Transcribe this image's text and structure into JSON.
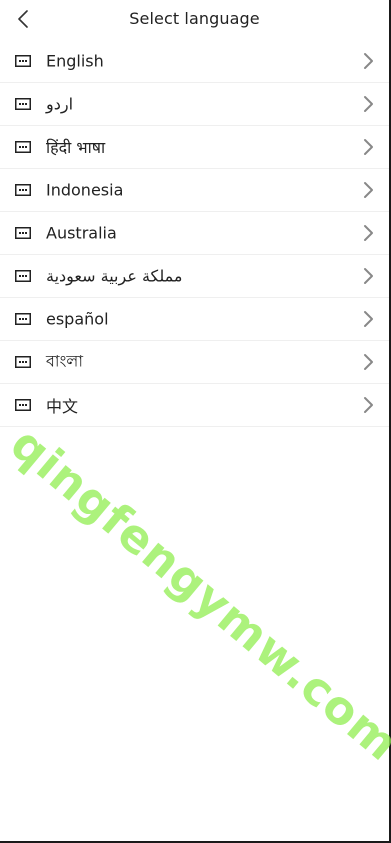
{
  "header": {
    "title": "Select language",
    "back_icon": "chevron-left-icon"
  },
  "languages": [
    {
      "label": "English"
    },
    {
      "label": "اردو"
    },
    {
      "label": "हिंदी भाषा"
    },
    {
      "label": "Indonesia"
    },
    {
      "label": "Australia"
    },
    {
      "label": "مملكة عربية سعودية"
    },
    {
      "label": "español"
    },
    {
      "label": "বাংলা"
    },
    {
      "label": "中文"
    }
  ],
  "icons": {
    "flag": "flag-placeholder-icon",
    "chevron": "chevron-right-icon"
  },
  "watermark": "qingfengymw.com",
  "colors": {
    "text": "#222222",
    "divider": "#efefef",
    "chevron": "#888888",
    "watermark": "#90ee50"
  }
}
